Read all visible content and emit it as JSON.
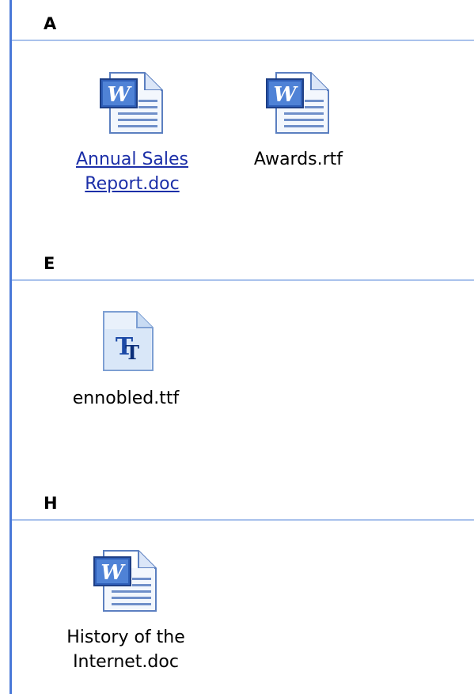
{
  "groups": [
    {
      "letter": "A",
      "files": [
        {
          "name": "Annual Sales Report.doc",
          "name_lines": [
            "Annual Sales",
            "Report.doc"
          ],
          "icon": "word-document-icon",
          "hovered": true
        },
        {
          "name": "Awards.rtf",
          "name_lines": [
            "Awards.rtf"
          ],
          "icon": "word-document-icon",
          "hovered": false
        }
      ]
    },
    {
      "letter": "E",
      "files": [
        {
          "name": "ennobled.ttf",
          "name_lines": [
            "ennobled.ttf"
          ],
          "icon": "truetype-font-icon",
          "hovered": false
        }
      ]
    },
    {
      "letter": "H",
      "files": [
        {
          "name": "History of the Internet.doc",
          "name_lines": [
            "History of the",
            "Internet.doc"
          ],
          "icon": "word-document-icon",
          "hovered": false
        }
      ]
    }
  ],
  "colors": {
    "group_rule": "#a9c2ec",
    "left_rule": "#4a79d8",
    "link_text": "#1c2fa8"
  }
}
